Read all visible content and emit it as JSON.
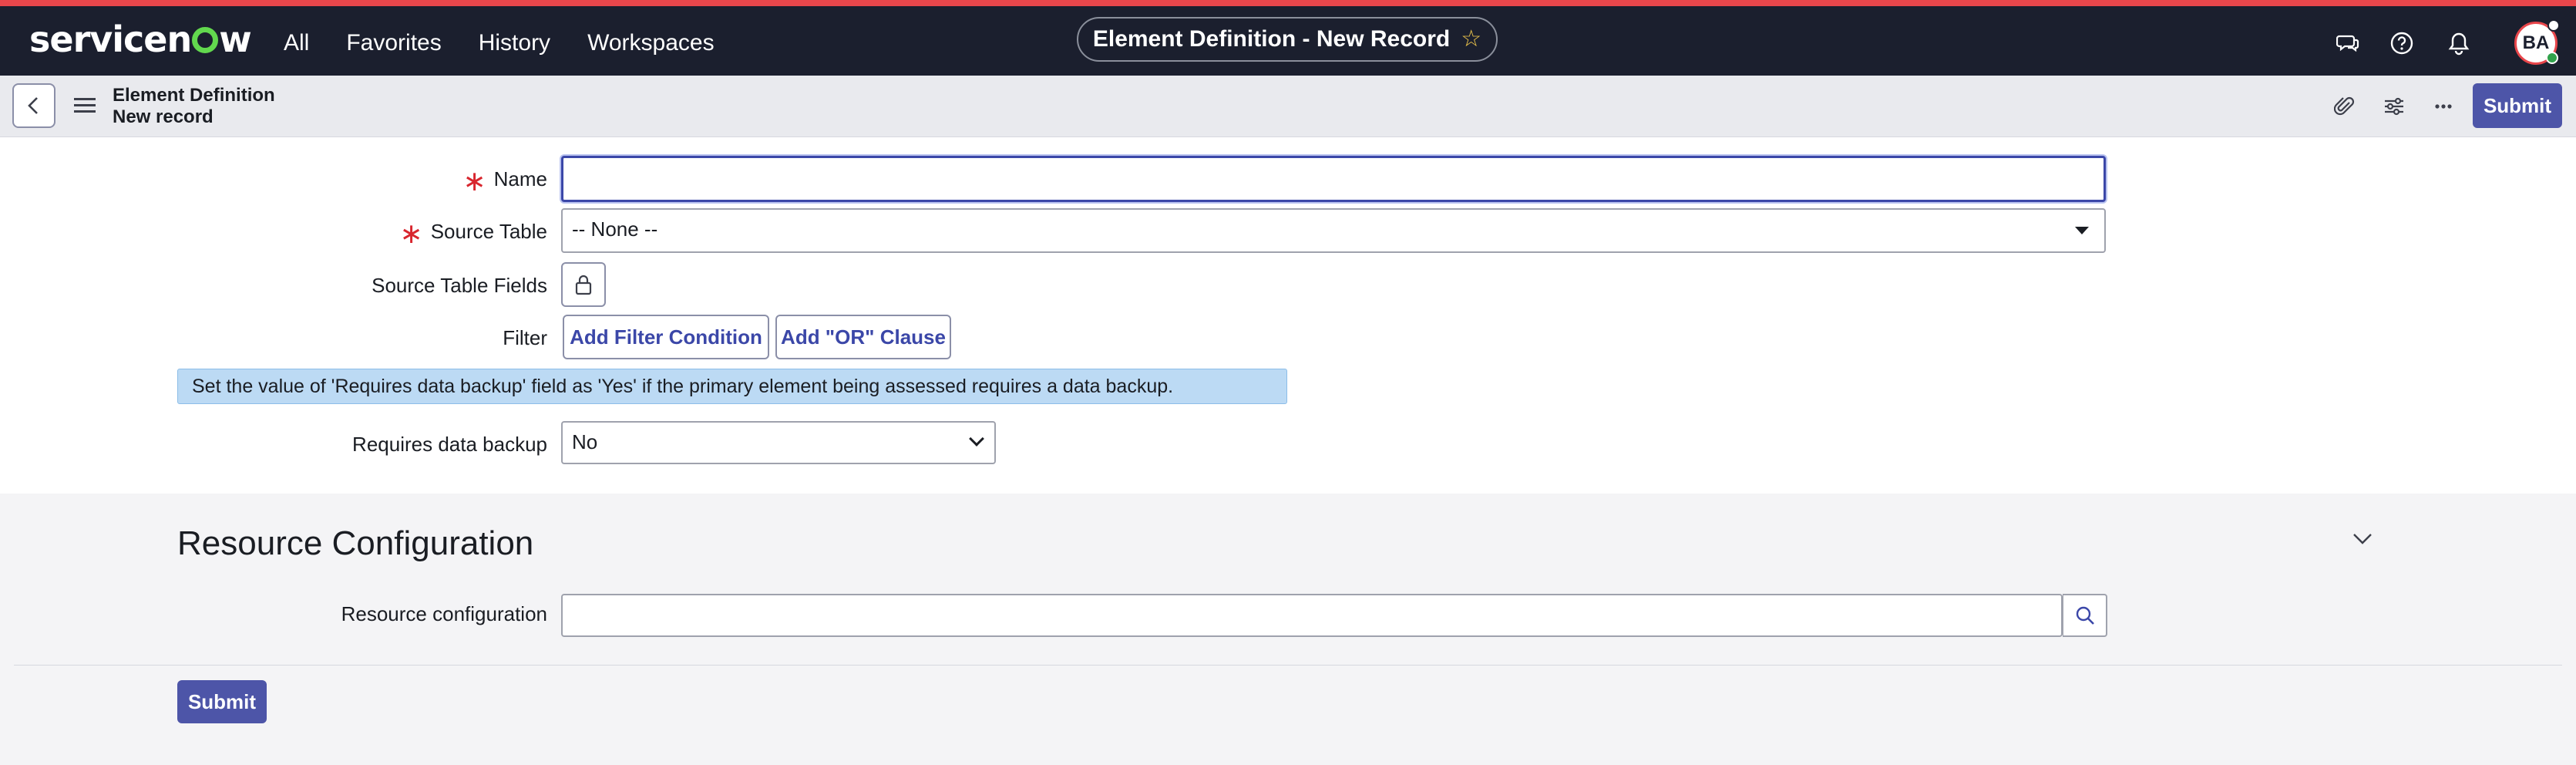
{
  "topnav": {
    "logo": "servicenow",
    "links": [
      "All",
      "Favorites",
      "History",
      "Workspaces"
    ],
    "title": "Element Definition - New Record",
    "avatar_initials": "BA"
  },
  "subheader": {
    "title": "Element Definition",
    "subtitle": "New record",
    "submit_label": "Submit"
  },
  "form": {
    "name": {
      "label": "Name",
      "value": ""
    },
    "source_table": {
      "label": "Source Table",
      "value": "-- None --"
    },
    "source_table_fields": {
      "label": "Source Table Fields"
    },
    "filter": {
      "label": "Filter",
      "add_condition": "Add Filter Condition",
      "add_or": "Add \"OR\" Clause"
    },
    "info": "Set the value of 'Requires data backup' field as 'Yes' if the primary element being assessed requires a data backup.",
    "requires_backup": {
      "label": "Requires data backup",
      "value": "No"
    }
  },
  "section": {
    "title": "Resource Configuration",
    "resource_config_label": "Resource configuration",
    "resource_config_value": "",
    "submit_label": "Submit"
  },
  "colors": {
    "nav_bg": "#1b1f2e",
    "accent_red": "#e8464b",
    "brand_green": "#62d84e",
    "primary_button": "#4d55a8",
    "info_banner": "#bcdaf4"
  }
}
